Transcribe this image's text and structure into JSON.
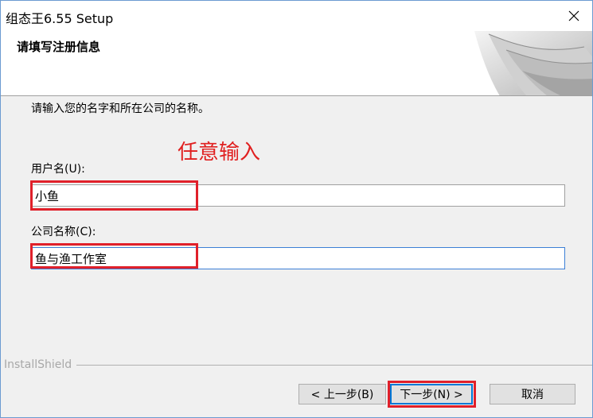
{
  "window": {
    "title": "组态王6.55 Setup"
  },
  "header": {
    "title": "请填写注册信息"
  },
  "body": {
    "intro": "请输入您的名字和所在公司的名称。",
    "annotation": "任意输入",
    "user_label": "用户名(U):",
    "user_value": "小鱼",
    "company_label": "公司名称(C):",
    "company_value": "鱼与渔工作室"
  },
  "footer": {
    "brand": "InstallShield",
    "back_label": "< 上一步(B)",
    "next_label": "下一步(N) >",
    "cancel_label": "取消"
  },
  "colors": {
    "highlight": "#e0202a",
    "annotation": "#e02020",
    "focus": "#3c7fd6"
  }
}
